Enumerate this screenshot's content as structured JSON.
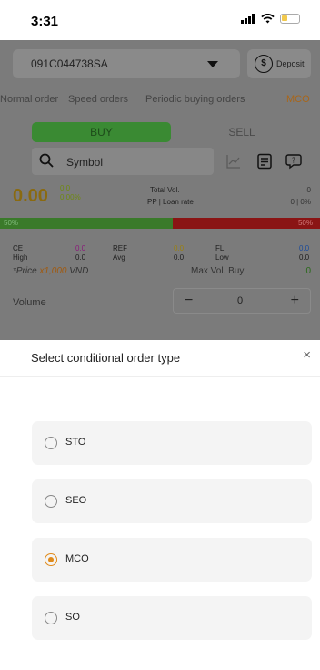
{
  "status_bar": {
    "time": "3:31"
  },
  "account": {
    "number": "091C044738SA",
    "deposit_label": "Deposit"
  },
  "order_tabs": [
    "Normal order",
    "Speed orders",
    "Periodic buying orders",
    "MCO"
  ],
  "trade": {
    "buy_label": "BUY",
    "sell_label": "SELL"
  },
  "symbol": {
    "placeholder": "Symbol"
  },
  "quote": {
    "price": "0.00",
    "change": "0.0",
    "change_pct": "0.00%",
    "total_vol_label": "Total Vol.",
    "total_vol_value": "0",
    "pp_label": "PP | Loan rate",
    "pp_value": "0 | 0%",
    "buy_ratio": "50%",
    "sell_ratio": "50%"
  },
  "stats": {
    "ce_label": "CE",
    "ce_value": "0.0",
    "ref_label": "REF",
    "ref_value": "0.0",
    "fl_label": "FL",
    "fl_value": "0.0",
    "high_label": "High",
    "high_value": "0.0",
    "avg_label": "Avg",
    "avg_value": "0.0",
    "low_label": "Low",
    "low_value": "0.0"
  },
  "price_note": {
    "prefix": "*Price ",
    "highlight": "x1,000",
    "suffix": " VND"
  },
  "max_vol": {
    "label": "Max Vol. Buy",
    "value": "0"
  },
  "volume": {
    "label": "Volume",
    "minus": "−",
    "value": "0",
    "plus": "+"
  },
  "sheet": {
    "title": "Select conditional order type",
    "close": "×",
    "options": [
      {
        "label": "STO",
        "selected": false
      },
      {
        "label": "SEO",
        "selected": false
      },
      {
        "label": "MCO",
        "selected": true
      },
      {
        "label": "SO",
        "selected": false
      }
    ]
  },
  "colors": {
    "accent": "#e08a1a",
    "buy": "#4caf50",
    "sell": "#e53935"
  }
}
